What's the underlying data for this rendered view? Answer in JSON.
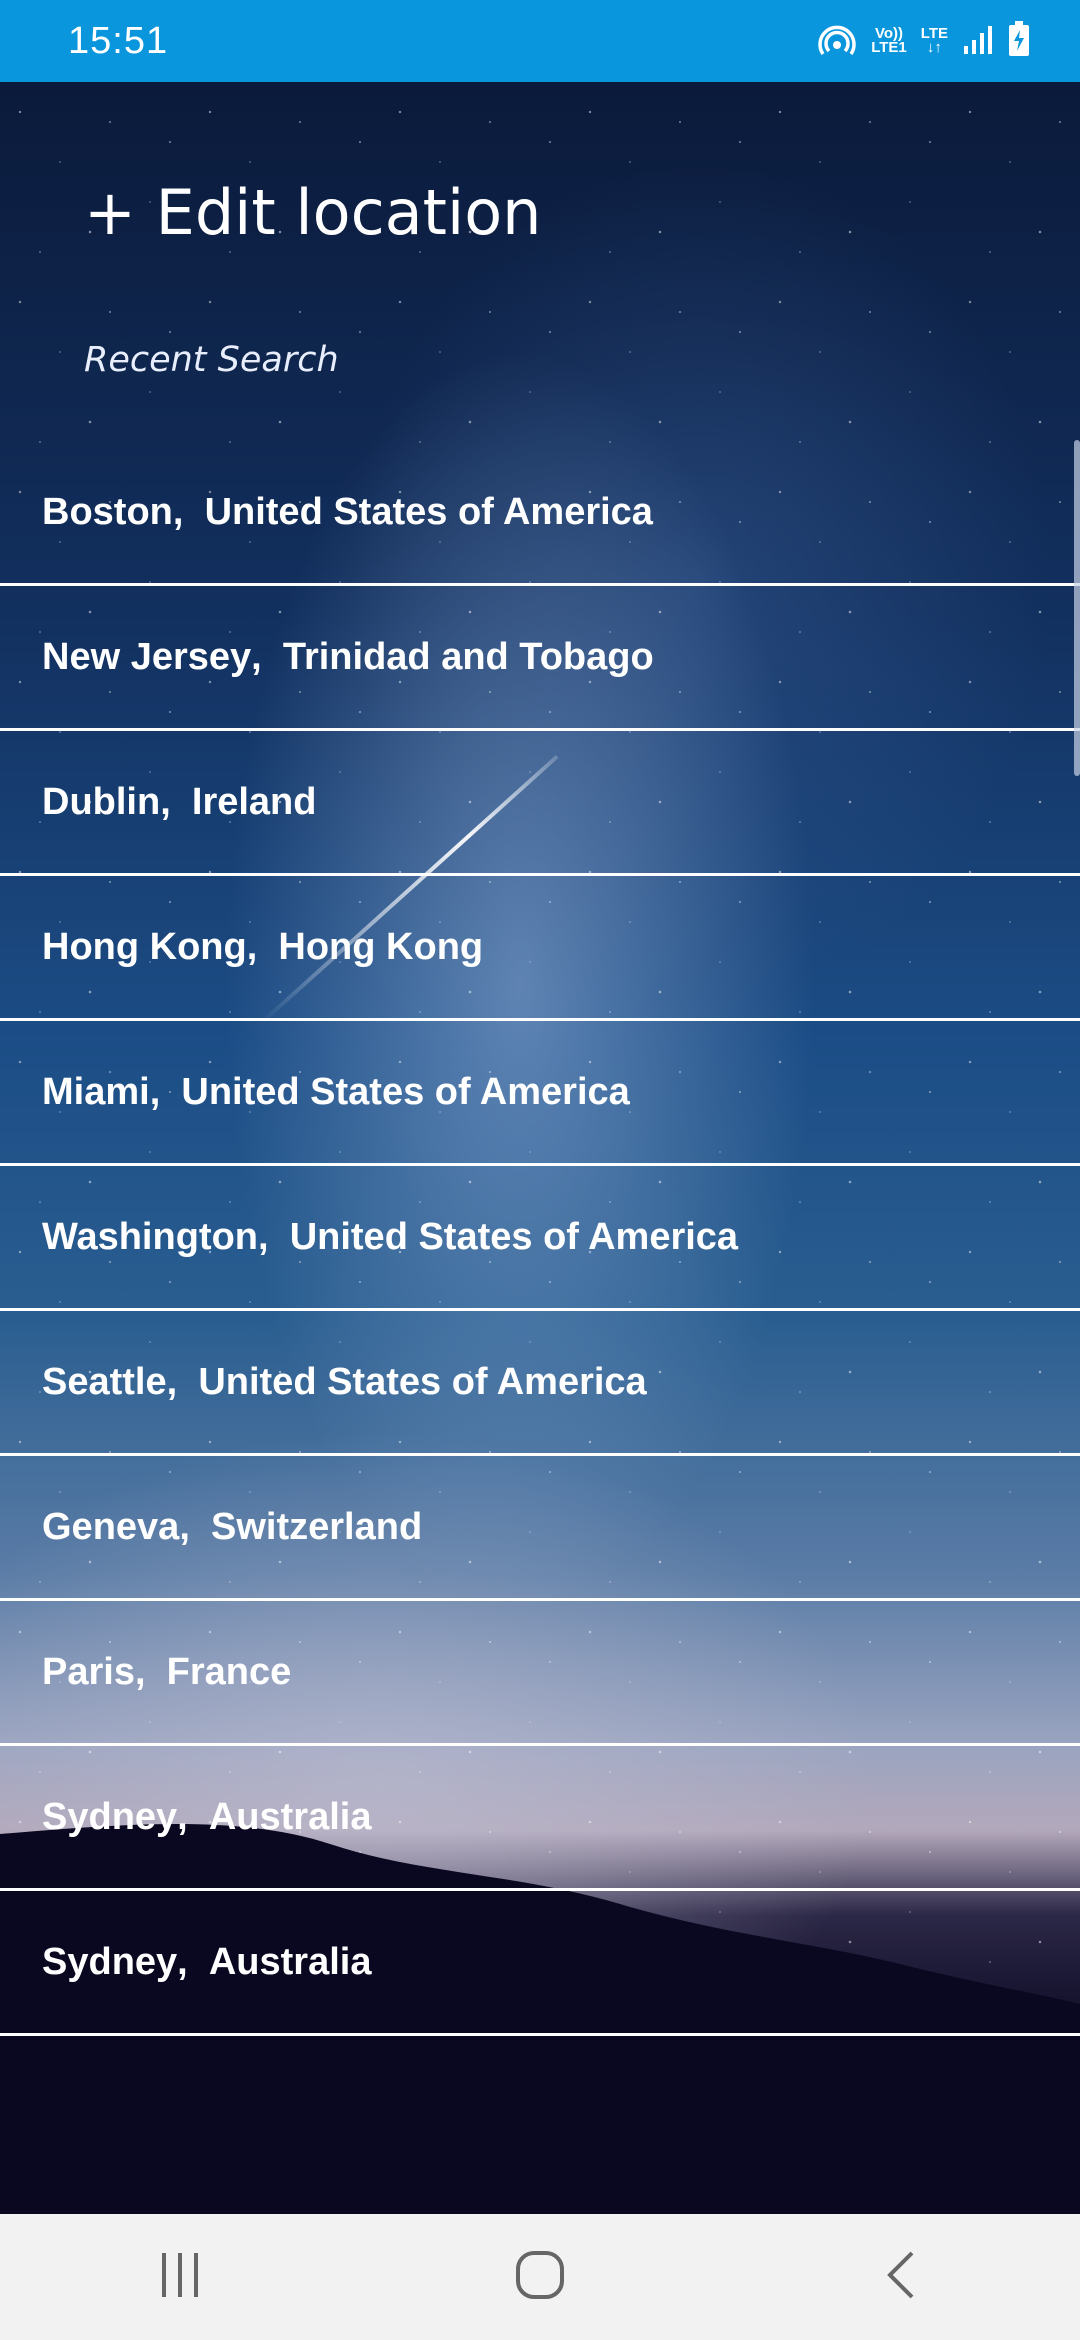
{
  "status_bar": {
    "time": "15:51",
    "volte_top": "Vo))",
    "volte_bottom": "LTE1",
    "lte_label": "LTE"
  },
  "header": {
    "edit_location_label": "+ Edit location",
    "recent_label": "Recent Search"
  },
  "locations": [
    {
      "city": "Boston",
      "country": "United States of America"
    },
    {
      "city": "New Jersey",
      "country": "Trinidad and Tobago"
    },
    {
      "city": "Dublin",
      "country": "Ireland"
    },
    {
      "city": "Hong Kong",
      "country": "Hong Kong"
    },
    {
      "city": "Miami",
      "country": "United States of America"
    },
    {
      "city": "Washington",
      "country": "United States of America"
    },
    {
      "city": "Seattle",
      "country": "United States of America"
    },
    {
      "city": "Geneva",
      "country": "Switzerland"
    },
    {
      "city": "Paris",
      "country": "France"
    },
    {
      "city": "Sydney",
      "country": "Australia"
    },
    {
      "city": "Sydney",
      "country": "Australia"
    }
  ],
  "separator": ",  ",
  "colors": {
    "status_bar": "#0a96dd",
    "nav_bar": "#f2f2f2",
    "text": "#ffffff",
    "nav_icon": "#666666"
  },
  "icons": {
    "hotspot": "hotspot-icon",
    "signal": "signal-icon",
    "battery": "battery-charging-icon",
    "recents": "recent-apps-icon",
    "home": "home-icon",
    "back": "back-icon"
  }
}
